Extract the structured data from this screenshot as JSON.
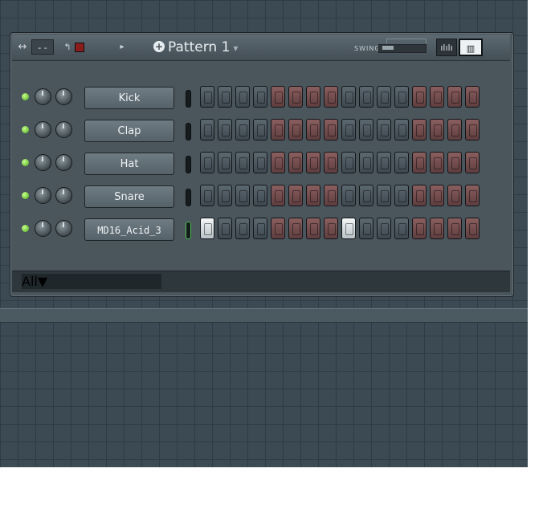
{
  "toolbar": {
    "pattern_label": "Pattern 1",
    "swing_label": "SWING",
    "view_buttons": [
      {
        "name": "graph-editor-button",
        "label": "ılılı"
      },
      {
        "name": "piano-roll-button",
        "label": "▥"
      }
    ]
  },
  "channels": [
    {
      "name": "Kick",
      "steps_on": []
    },
    {
      "name": "Clap",
      "steps_on": []
    },
    {
      "name": "Hat",
      "steps_on": []
    },
    {
      "name": "Snare",
      "steps_on": []
    },
    {
      "name": "MD16_Acid_3",
      "steps_on": [
        0,
        8
      ]
    }
  ],
  "step_pattern": [
    "gray",
    "gray",
    "gray",
    "gray",
    "red",
    "red",
    "red",
    "red",
    "gray",
    "gray",
    "gray",
    "gray",
    "red",
    "red",
    "red",
    "red"
  ],
  "filter": {
    "value": "All"
  },
  "piano_roll": {
    "columns": 16,
    "highlighted_columns": [
      0,
      8
    ]
  },
  "colors": {
    "annotation_box": "#e01a1a",
    "annotation_ellipse": "#f0e000",
    "annotation_arrows": "#5b9bd5"
  }
}
